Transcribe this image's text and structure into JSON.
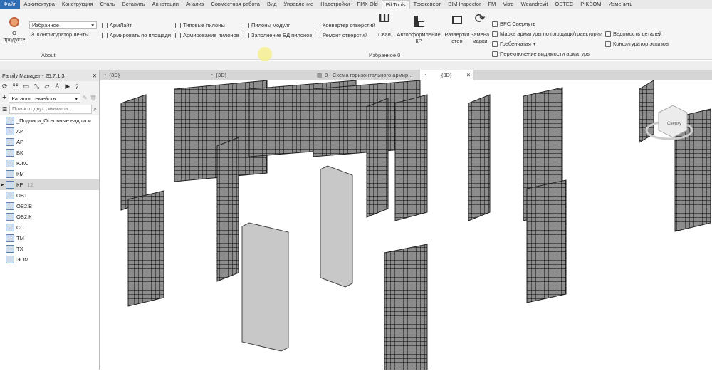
{
  "menu": [
    "Файл",
    "Архитектура",
    "Конструкция",
    "Сталь",
    "Вставить",
    "Аннотации",
    "Анализ",
    "Совместная работа",
    "Вид",
    "Управление",
    "Надстройки",
    "ПИК-Old",
    "PikTools",
    "Техэксперт",
    "BIM Inspector",
    "FM",
    "Vitro",
    "Weandrevit",
    "OSTEC",
    "PIKEOM",
    "Изменить"
  ],
  "ribbon": {
    "about": "О продукте",
    "favorites_select": "Избранное",
    "config": "Конфигуратор ленты",
    "group_about": "About",
    "armlite": "АрмЛайт",
    "arm_area": "Армировать  по площади",
    "typ_pylons": "Типовые  пилоны",
    "arm_pylons": "Армирование  пилонов",
    "pylons_module": "Пилоны модуля",
    "fill_db": "Заполнение БД пилонов",
    "converter": "Конвертер  отверстий",
    "repair": "Ремонт отверстий",
    "piles": "Сваи",
    "auto_kr": "Автооформление КР",
    "unfold": "Развертки стен",
    "replace": "Замена марки",
    "vrs": "ВРС  Свернуть",
    "mark": "Марка арматуры  по площади/траектории",
    "comb": "Гребенчатая",
    "toggle": "Переключение  видимости арматуры",
    "details": "Ведомость деталей",
    "sketch": "Конфигуратор эскизов",
    "group_fav": "Избранное 0"
  },
  "family_manager": {
    "title": "Family Manager - 25.7.1.3",
    "catalog": "Каталог семейств",
    "search_placeholder": "Поиск от двух символов...",
    "items": [
      {
        "label": "_Подписи_Основные надписи"
      },
      {
        "label": "АИ"
      },
      {
        "label": "АР"
      },
      {
        "label": "ВК"
      },
      {
        "label": "ЮКС"
      },
      {
        "label": "КМ"
      },
      {
        "label": "КР",
        "count": "12"
      },
      {
        "label": "ОВ1"
      },
      {
        "label": "ОВ2.В"
      },
      {
        "label": "ОВ2.К"
      },
      {
        "label": "СС"
      },
      {
        "label": "ТМ"
      },
      {
        "label": "ТХ"
      },
      {
        "label": "ЭОМ"
      }
    ]
  },
  "view_tabs": [
    "{3D}",
    "{3D}",
    "8 - Схема горизонтального армир...",
    "{3D}"
  ],
  "viewcube": "Сверху"
}
